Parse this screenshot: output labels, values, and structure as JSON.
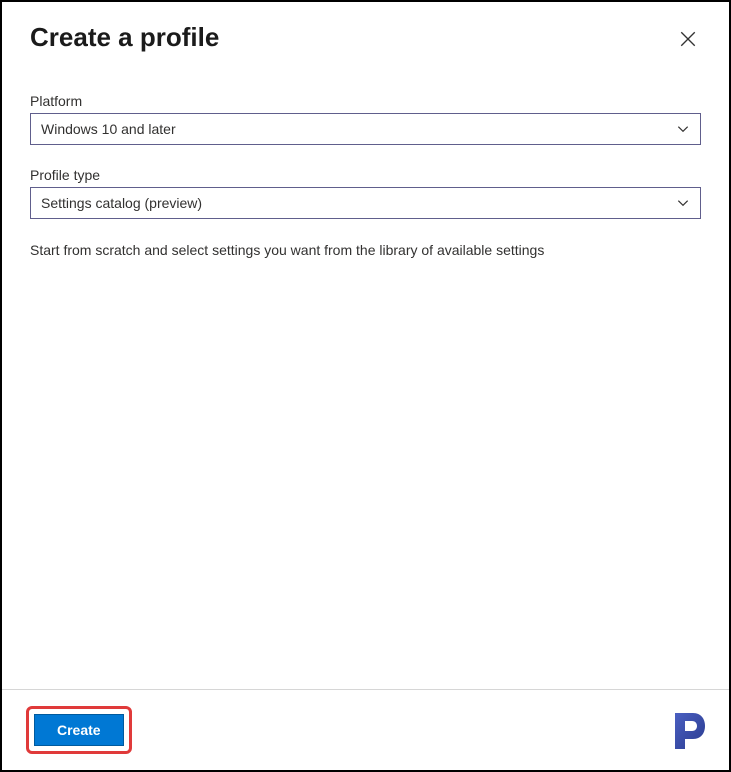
{
  "header": {
    "title": "Create a profile"
  },
  "fields": {
    "platform": {
      "label": "Platform",
      "value": "Windows 10 and later"
    },
    "profileType": {
      "label": "Profile type",
      "value": "Settings catalog (preview)"
    }
  },
  "description": "Start from scratch and select settings you want from the library of available settings",
  "footer": {
    "createLabel": "Create"
  }
}
